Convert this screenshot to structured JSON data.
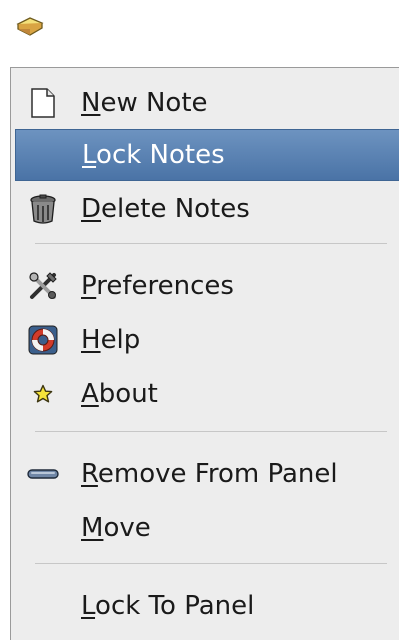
{
  "applet": {
    "icon": "sticky-notes-applet-icon"
  },
  "menu": {
    "items": [
      {
        "key": "new_note",
        "mnemonic": "N",
        "rest": "ew Note",
        "icon": "new-document-icon",
        "selected": false
      },
      {
        "key": "lock_notes",
        "mnemonic": "L",
        "rest": "ock Notes",
        "icon": "",
        "selected": true
      },
      {
        "key": "delete_notes",
        "mnemonic": "D",
        "rest": "elete Notes",
        "icon": "trash-can-icon",
        "selected": false
      },
      {
        "key": "preferences",
        "mnemonic": "P",
        "rest": "references",
        "icon": "tools-icon",
        "selected": false
      },
      {
        "key": "help",
        "mnemonic": "H",
        "rest": "elp",
        "icon": "lifebuoy-icon",
        "selected": false
      },
      {
        "key": "about",
        "mnemonic": "A",
        "rest": "bout",
        "icon": "star-icon",
        "selected": false
      },
      {
        "key": "remove_from_panel",
        "mnemonic": "R",
        "rest": "emove From Panel",
        "icon": "remove-icon",
        "selected": false
      },
      {
        "key": "move",
        "mnemonic": "M",
        "rest": "ove",
        "icon": "",
        "selected": false
      },
      {
        "key": "lock_to_panel",
        "mnemonic": "L",
        "rest": "ock To Panel",
        "icon": "",
        "selected": false
      }
    ]
  },
  "colors": {
    "selection": "#4a73a6",
    "menu_background": "#ededed"
  }
}
